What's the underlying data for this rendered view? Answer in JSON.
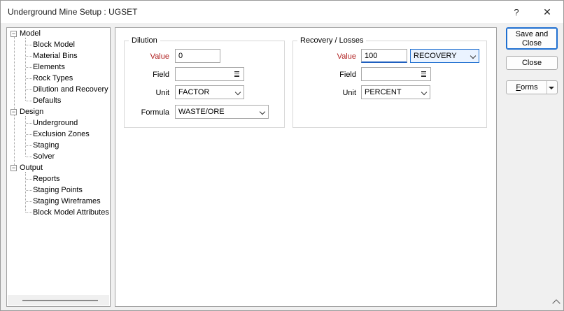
{
  "window": {
    "title": "Underground Mine Setup : UGSET",
    "help_label": "?",
    "close_label": "✕"
  },
  "tree": {
    "groups": [
      {
        "label": "Model",
        "expander": "−",
        "children": [
          "Block Model",
          "Material Bins",
          "Elements",
          "Rock Types",
          "Dilution and Recovery",
          "Defaults"
        ]
      },
      {
        "label": "Design",
        "expander": "−",
        "children": [
          "Underground",
          "Exclusion Zones",
          "Staging",
          "Solver"
        ]
      },
      {
        "label": "Output",
        "expander": "−",
        "children": [
          "Reports",
          "Staging Points",
          "Staging Wireframes",
          "Block Model Attributes"
        ]
      }
    ]
  },
  "dilution": {
    "title": "Dilution",
    "value_label": "Value",
    "value": "0",
    "field_label": "Field",
    "field": "",
    "unit_label": "Unit",
    "unit": "FACTOR",
    "formula_label": "Formula",
    "formula": "WASTE/ORE"
  },
  "recovery": {
    "title": "Recovery / Losses",
    "value_label": "Value",
    "value": "100",
    "type": "RECOVERY",
    "field_label": "Field",
    "field": "",
    "unit_label": "Unit",
    "unit": "PERCENT"
  },
  "buttons": {
    "save_close": "Save and Close",
    "close": "Close",
    "forms_prefix": "",
    "forms_underline": "F",
    "forms_rest": "orms"
  },
  "colors": {
    "accent": "#1f6fd0",
    "required_label": "#b02020"
  }
}
